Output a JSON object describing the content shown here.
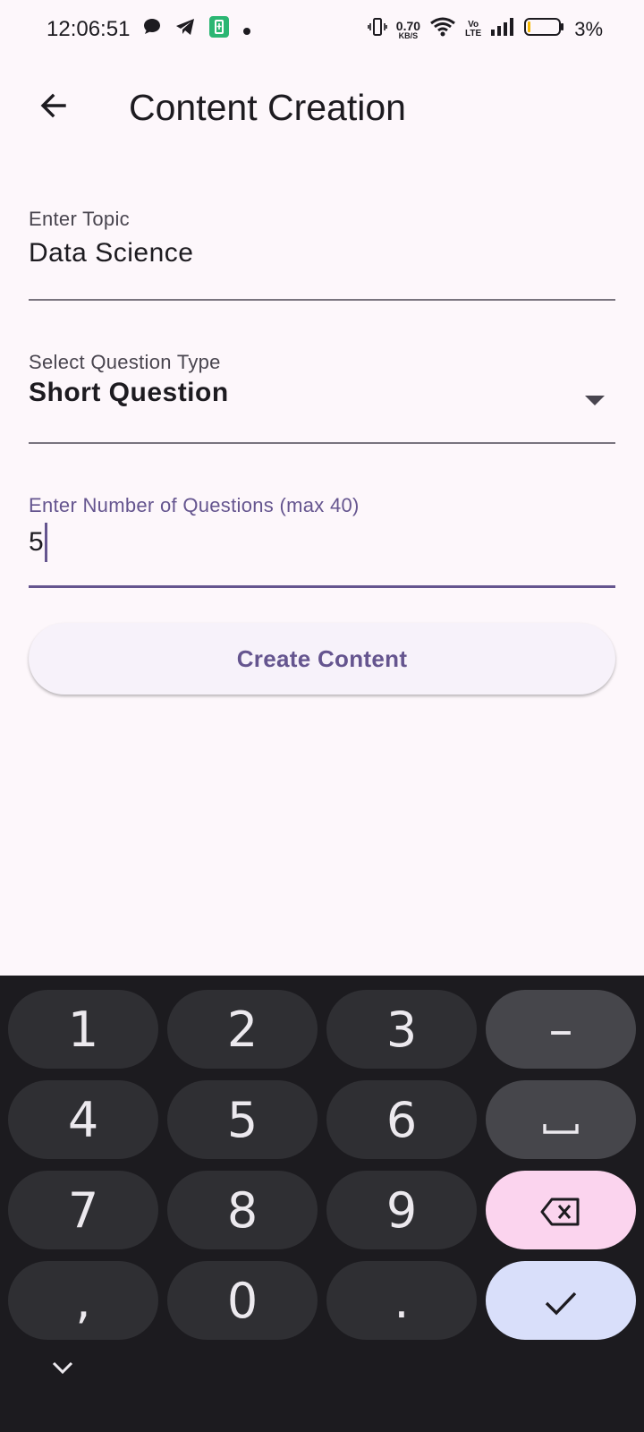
{
  "status_bar": {
    "time": "12:06:51",
    "net_speed_value": "0.70",
    "net_speed_unit": "KB/S",
    "volte_top": "Vo",
    "volte_bottom": "LTE",
    "battery_percent": "3%",
    "icons": [
      "chat-icon",
      "telegram-icon",
      "battery-saver-icon",
      "dot-icon",
      "vibrate-icon",
      "wifi-icon",
      "signal-icon",
      "battery-icon"
    ]
  },
  "app_bar": {
    "back_icon": "arrow-left-icon",
    "title": "Content Creation"
  },
  "form": {
    "topic": {
      "label": "Enter Topic",
      "value": "Data Science"
    },
    "question_type": {
      "label": "Select Question Type",
      "value": "Short Question",
      "icon": "caret-down-icon"
    },
    "question_count": {
      "label": "Enter Number of Questions (max 40)",
      "value": "5"
    },
    "submit_label": "Create Content"
  },
  "keyboard": {
    "keys": [
      [
        "1",
        "2",
        "3",
        "–"
      ],
      [
        "4",
        "5",
        "6",
        "␣"
      ],
      [
        "7",
        "8",
        "9",
        "backspace"
      ],
      [
        ",",
        "0",
        ".",
        "enter"
      ]
    ],
    "colors": {
      "background": "#1c1b1f",
      "key": "#2f2f33",
      "function_key": "#46464b",
      "backspace_key": "#fbd4ee",
      "enter_key": "#d9dffa"
    }
  },
  "theme": {
    "accent": "#65558f",
    "background": "#fdf7fb"
  }
}
